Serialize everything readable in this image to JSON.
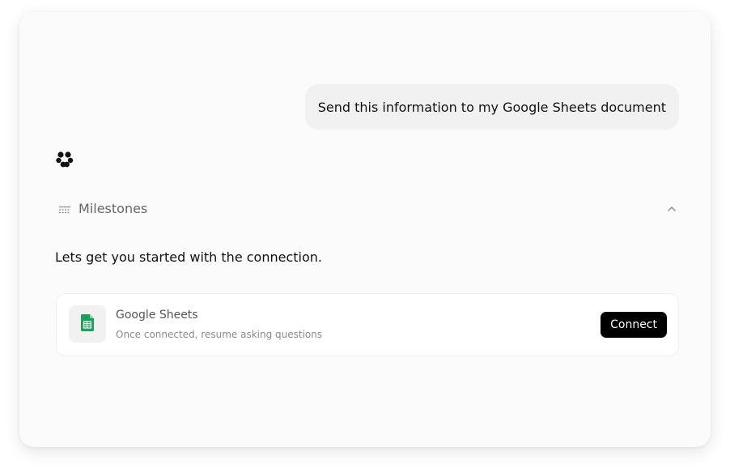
{
  "chat": {
    "user_message": "Send this information to my Google Sheets document",
    "bot_avatar_icon": "bot-logo-icon",
    "milestones": {
      "label": "Milestones",
      "icon": "milestones-icon",
      "toggle_icon": "chevron-up-icon",
      "expanded": true
    },
    "assistant_message": "Lets get you started with the connection."
  },
  "integration": {
    "app_name": "Google Sheets",
    "app_icon": "google-sheets-icon",
    "app_icon_color": "#1e9e5a",
    "subtitle": "Once connected, resume asking questions",
    "connect_label": "Connect"
  }
}
